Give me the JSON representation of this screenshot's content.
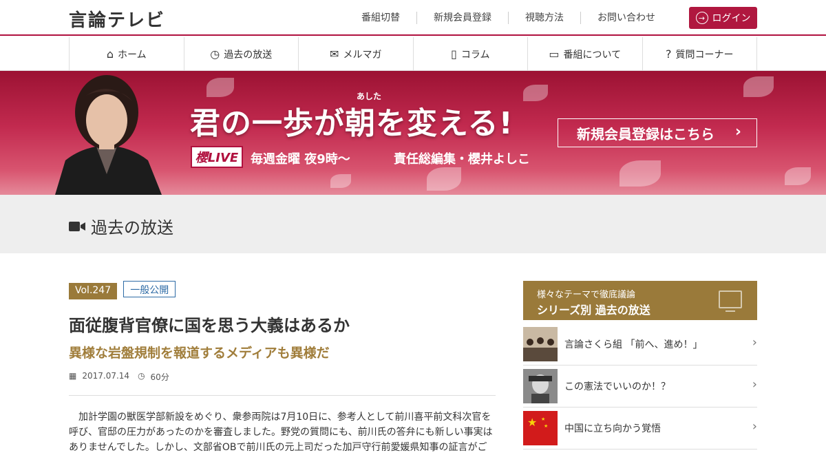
{
  "logo": "言論テレビ",
  "toplinks": [
    "番組切替",
    "新規会員登録",
    "視聴方法",
    "お問い合わせ"
  ],
  "login": {
    "label": "ログイン",
    "icon": "login-icon"
  },
  "nav": [
    {
      "label": "ホーム",
      "icon": "home-icon"
    },
    {
      "label": "過去の放送",
      "icon": "clock-icon"
    },
    {
      "label": "メルマガ",
      "icon": "mail-icon"
    },
    {
      "label": "コラム",
      "icon": "document-icon"
    },
    {
      "label": "番組について",
      "icon": "tv-icon"
    },
    {
      "label": "質問コーナー",
      "icon": "question-icon"
    }
  ],
  "banner": {
    "ruby": "あした",
    "title": "君の一歩が朝を変える!",
    "live_badge": "櫻LIVE",
    "schedule": "毎週金曜 夜9時〜",
    "editor": "責任総編集・櫻井よしこ",
    "cta": "新規会員登録はこちら"
  },
  "section": {
    "title": "過去の放送",
    "icon": "video-camera-icon"
  },
  "article": {
    "vol": "Vol.247",
    "access": "一般公開",
    "title": "面従腹背官僚に国を思う大義はあるか",
    "subtitle": "異様な岩盤規制を報道するメディアも異様だ",
    "date": "2017.07.14",
    "duration": "60分",
    "body": "加計学園の獣医学部新設をめぐり、衆参両院は7月10日に、参考人として前川喜平前文科次官を呼び、官邸の圧力があったのかを審査しました。野党の質問にも、前川氏の答弁にも新しい事実はありませんでした。しかし、文部省OBで前川氏の元上司だった加戸守行前愛媛県知事の証言がご"
  },
  "sidebar": {
    "small": "様々なテーマで徹底議論",
    "big": "シリーズ別 過去の放送",
    "items": [
      {
        "label": "言論さくら組 「前へ、進め！」"
      },
      {
        "label": "この憲法でいいのか！？"
      },
      {
        "label": "中国に立ち向かう覚悟"
      }
    ]
  },
  "colors": {
    "brand": "#b0173f",
    "gold": "#9a7a3a",
    "link_blue": "#2d6aa5"
  }
}
